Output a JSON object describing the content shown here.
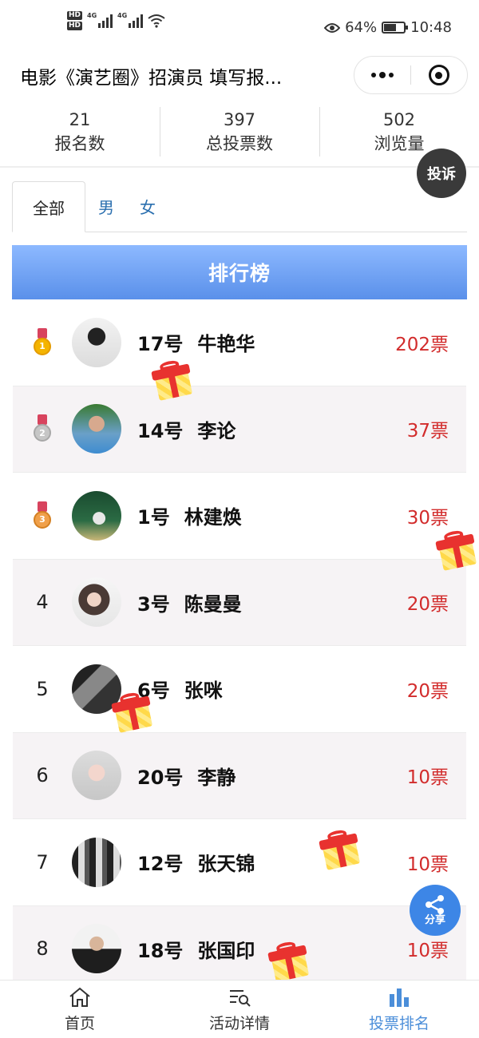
{
  "status_bar": {
    "network_left": [
      "HD",
      "HD"
    ],
    "signal1_label": "4G",
    "signal2_label": "4G",
    "battery_percent": "64%",
    "battery_level": 0.64,
    "time": "10:48"
  },
  "header": {
    "title": "电影《演艺圈》招演员 填写报..."
  },
  "stats": [
    {
      "value": "21",
      "label": "报名数"
    },
    {
      "value": "397",
      "label": "总投票数"
    },
    {
      "value": "502",
      "label": "浏览量"
    }
  ],
  "complain_label": "投诉",
  "tabs": [
    "全部",
    "男",
    "女"
  ],
  "ranking": {
    "title": "排行榜",
    "rows": [
      {
        "rank": "1",
        "number": "17号",
        "name": "牛艳华",
        "votes": "202票"
      },
      {
        "rank": "2",
        "number": "14号",
        "name": "李论",
        "votes": "37票"
      },
      {
        "rank": "3",
        "number": "1号",
        "name": "林建焕",
        "votes": "30票"
      },
      {
        "rank": "4",
        "number": "3号",
        "name": "陈曼曼",
        "votes": "20票"
      },
      {
        "rank": "5",
        "number": "6号",
        "name": "张咪",
        "votes": "20票"
      },
      {
        "rank": "6",
        "number": "20号",
        "name": "李静",
        "votes": "10票"
      },
      {
        "rank": "7",
        "number": "12号",
        "name": "张天锦",
        "votes": "10票"
      },
      {
        "rank": "8",
        "number": "18号",
        "name": "张国印",
        "votes": "10票"
      }
    ]
  },
  "share_label": "分享",
  "bottom_nav": [
    {
      "label": "首页",
      "icon": "home-icon"
    },
    {
      "label": "活动详情",
      "icon": "list-search-icon"
    },
    {
      "label": "投票排名",
      "icon": "bar-chart-icon"
    }
  ],
  "colors": {
    "accent_blue": "#4b8ed9",
    "vote_red": "#d22c2c",
    "rank_header_top": "#8db9ff",
    "rank_header_bottom": "#5a90ea"
  }
}
